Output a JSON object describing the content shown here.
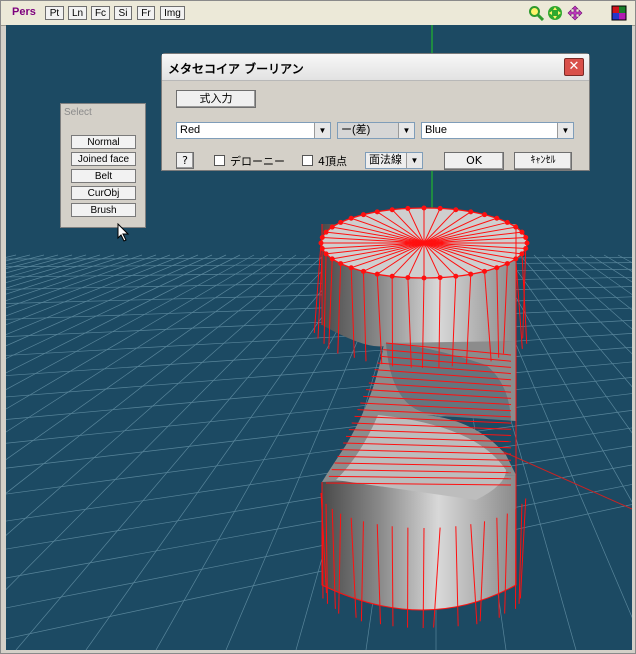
{
  "toolbar": {
    "view_label": "Pers",
    "buttons": [
      "Pt",
      "Ln",
      "Fc",
      "Si",
      "Fr",
      "Img"
    ]
  },
  "select_panel": {
    "title": "Select",
    "buttons": [
      "Normal",
      "Joined face",
      "Belt",
      "CurObj",
      "Brush"
    ]
  },
  "dialog": {
    "title": "メタセコイア ブーリアン",
    "close_label": "✕",
    "formula_button": "式入力",
    "object_a": "Red",
    "operation": "ー(差)",
    "object_b": "Blue",
    "help_button": "?",
    "delaunay_label": "デローニー",
    "quad_label": "4頂点",
    "normal_select": "面法線",
    "ok_button": "OK",
    "cancel_button": "ｷｬﾝｾﾙ"
  },
  "colors": {
    "viewport_bg": "#1c4a63",
    "wire": "#ff1010",
    "axis_y": "#22cc22",
    "axis_x": "#cc2222"
  }
}
